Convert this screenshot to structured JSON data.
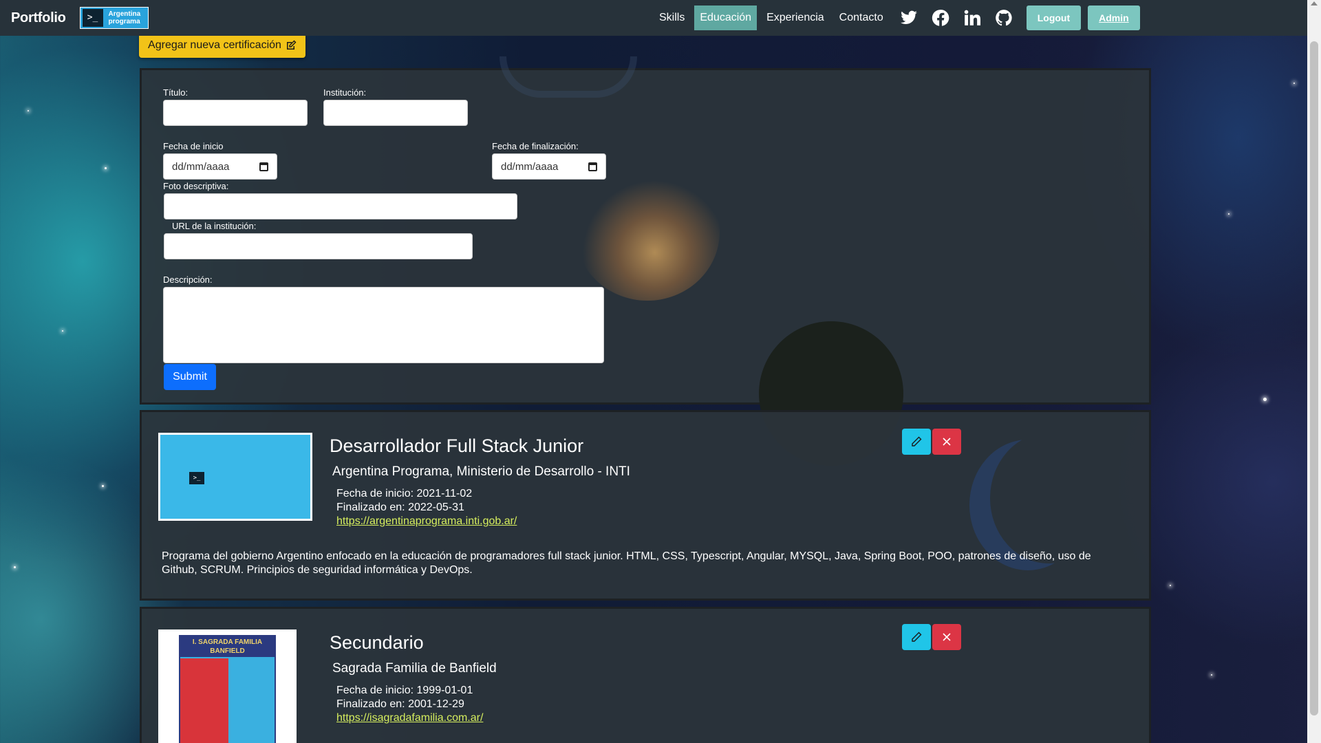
{
  "navbar": {
    "brand": "Portfolio",
    "logo_text_line1": "Argentina",
    "logo_text_line2": "programa",
    "links": [
      "Skills",
      "Educación",
      "Experiencia",
      "Contacto"
    ],
    "active_link": "Educación",
    "social_icons": [
      "twitter-icon",
      "facebook-icon",
      "linkedin-icon",
      "github-icon"
    ],
    "logout_label": "Logout",
    "admin_label": "Admin"
  },
  "add_certification": {
    "label": "Agregar nueva certificación",
    "icon": "edit-icon"
  },
  "form": {
    "titulo_label": "Título:",
    "institucion_label": "Institución:",
    "fecha_inicio_label": "Fecha de inicio",
    "fecha_fin_label": "Fecha de finalización:",
    "date_placeholder": "dd/mm/aaaa",
    "foto_label": "Foto descriptiva:",
    "url_label": "URL de la institución:",
    "descripcion_label": "Descripción:",
    "submit_label": "Submit"
  },
  "education": [
    {
      "title": "Desarrollador Full Stack Junior",
      "institution": "Argentina Programa, Ministerio de Desarrollo - INTI",
      "start": "Fecha de inicio: 2021-11-02",
      "end": "Finalizado en: 2022-05-31",
      "url": "https://argentinaprograma.inti.gob.ar/",
      "description": "Programa del gobierno Argentino enfocado en la educación de programadores full stack junior. HTML, CSS, Typescript, Angular, MYSQL, Java, Spring Boot, POO, patrones de diseño, uso de Github, SCRUM. Principios de seguridad informática y DevOps."
    },
    {
      "title": "Secundario",
      "institution": "Sagrada Familia de Banfield",
      "start": "Fecha de inicio: 1999-01-01",
      "end": "Finalizado en: 2001-12-29",
      "url": "https://isagradafamilia.com.ar/",
      "crest_text_line1": "I. SAGRADA FAMILIA",
      "crest_text_line2": "BANFIELD"
    }
  ],
  "colors": {
    "navbar_bg": "#27323a",
    "active_link_bg": "#5fa8a1",
    "teal_button": "#7cc6bf",
    "add_button": "#f2c318",
    "submit": "#0d6efd",
    "edit": "#20c5e8",
    "delete": "#dc3545",
    "link": "#d6ee5e"
  }
}
